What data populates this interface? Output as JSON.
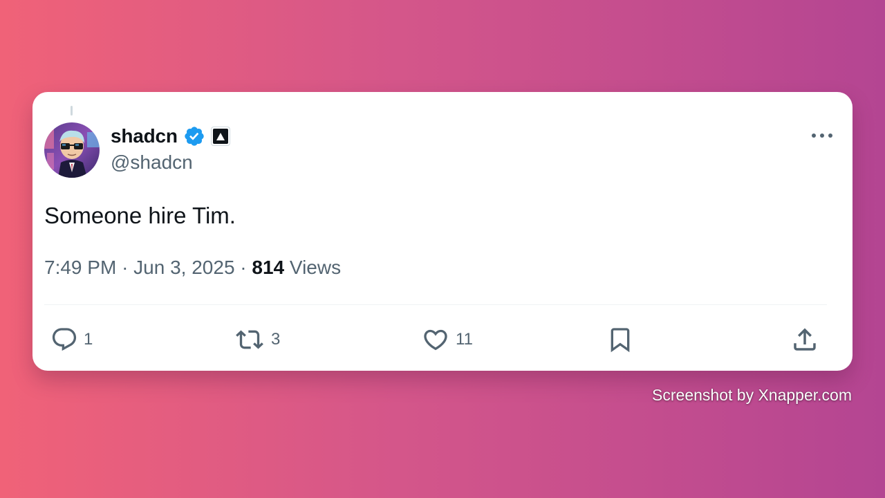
{
  "tweet": {
    "author": {
      "display_name": "shadcn",
      "handle": "@shadcn",
      "verified_icon": "verified-badge-icon",
      "affiliate_icon": "vercel-triangle-icon",
      "avatar": "avatar-image"
    },
    "text": "Someone hire Tim.",
    "time": "7:49 PM",
    "separator": "·",
    "date": "Jun 3, 2025",
    "views_count": "814",
    "views_label": "Views",
    "more_icon": "more-options-icon",
    "actions": {
      "reply": {
        "icon": "reply-icon",
        "count": "1"
      },
      "retweet": {
        "icon": "retweet-icon",
        "count": "3"
      },
      "like": {
        "icon": "heart-icon",
        "count": "11"
      },
      "bookmark": {
        "icon": "bookmark-icon"
      },
      "share": {
        "icon": "share-icon"
      }
    }
  },
  "watermark": "Screenshot by Xnapper.com",
  "colors": {
    "background_start": "#f06278",
    "background_end": "#b44592",
    "card": "#ffffff",
    "text_primary": "#0f1419",
    "text_secondary": "#536471",
    "verified_blue": "#1d9bf0"
  }
}
